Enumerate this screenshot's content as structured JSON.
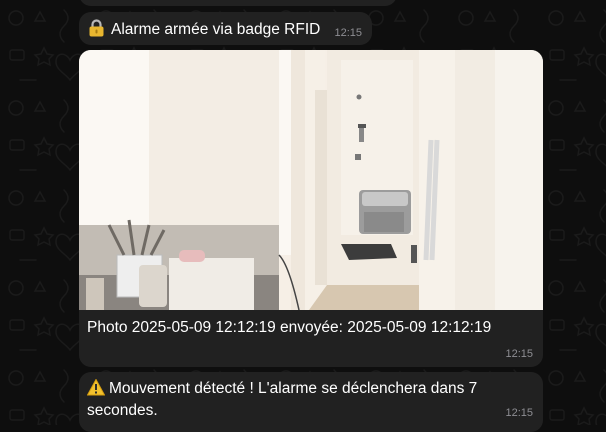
{
  "chat": {
    "messages": [
      {
        "icon": "lock-icon",
        "text": "Alarme armée via badge RFID",
        "time": "12:15"
      },
      {
        "type": "photo",
        "caption": "Photo 2025-05-09 12:12:19 envoyée: 2025-05-09 12:12:19",
        "time": "12:15"
      },
      {
        "icon": "warning-icon",
        "text": "Mouvement détecté ! L'alarme se déclenchera dans 7 secondes.",
        "time": "12:15"
      }
    ]
  },
  "colors": {
    "background": "#0e0e0e",
    "bubble": "#212121",
    "text": "#ffffff",
    "timestamp": "#8e8e93"
  }
}
